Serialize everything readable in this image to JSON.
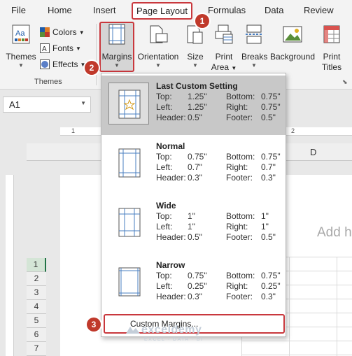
{
  "menu": {
    "tabs": [
      {
        "label": "File"
      },
      {
        "label": "Home"
      },
      {
        "label": "Insert"
      },
      {
        "label": "Page Layout"
      },
      {
        "label": "Formulas"
      },
      {
        "label": "Data"
      },
      {
        "label": "Review"
      }
    ],
    "active": "Page Layout"
  },
  "ribbon": {
    "themes": {
      "label": "Themes",
      "group_label": "Themes"
    },
    "colors": "Colors",
    "fonts": "Fonts",
    "effects": "Effects",
    "margins": "Margins",
    "orientation": "Orientation",
    "size": "Size",
    "print_area_line1": "Print",
    "print_area_line2": "Area",
    "breaks": "Breaks",
    "background": "Background",
    "print_titles_line1": "Print",
    "print_titles_line2": "Titles"
  },
  "badges": [
    "1",
    "2",
    "3"
  ],
  "name_box": "A1",
  "sheet": {
    "column_d": "D",
    "rows": [
      "1",
      "2",
      "3",
      "4",
      "5",
      "6",
      "7"
    ],
    "header_placeholder": "Add h",
    "ruler_numbers": [
      "1",
      "1",
      "2"
    ]
  },
  "margins_menu": {
    "options": [
      {
        "title": "Last Custom Setting",
        "top": "1.25\"",
        "bottom": "0.75\"",
        "left": "1.25\"",
        "right": "0.75\"",
        "header": "0.5\"",
        "footer": "0.5\""
      },
      {
        "title": "Normal",
        "top": "0.75\"",
        "bottom": "0.75\"",
        "left": "0.7\"",
        "right": "0.7\"",
        "header": "0.3\"",
        "footer": "0.3\""
      },
      {
        "title": "Wide",
        "top": "1\"",
        "bottom": "1\"",
        "left": "1\"",
        "right": "1\"",
        "header": "0.5\"",
        "footer": "0.5\""
      },
      {
        "title": "Narrow",
        "top": "0.75\"",
        "bottom": "0.75\"",
        "left": "0.25\"",
        "right": "0.25\"",
        "header": "0.3\"",
        "footer": "0.3\""
      }
    ],
    "labels": {
      "top": "Top:",
      "bottom": "Bottom:",
      "left": "Left:",
      "right": "Right:",
      "header": "Header:",
      "footer": "Footer:"
    },
    "custom_margins": "Custom Margins..."
  },
  "watermark": {
    "name": "exceldemy",
    "tagline": "EXCEL · DATA · BI"
  },
  "colors": {
    "accent_red": "#c9383d",
    "excel_green": "#217346",
    "badge_red": "#c0392b"
  }
}
